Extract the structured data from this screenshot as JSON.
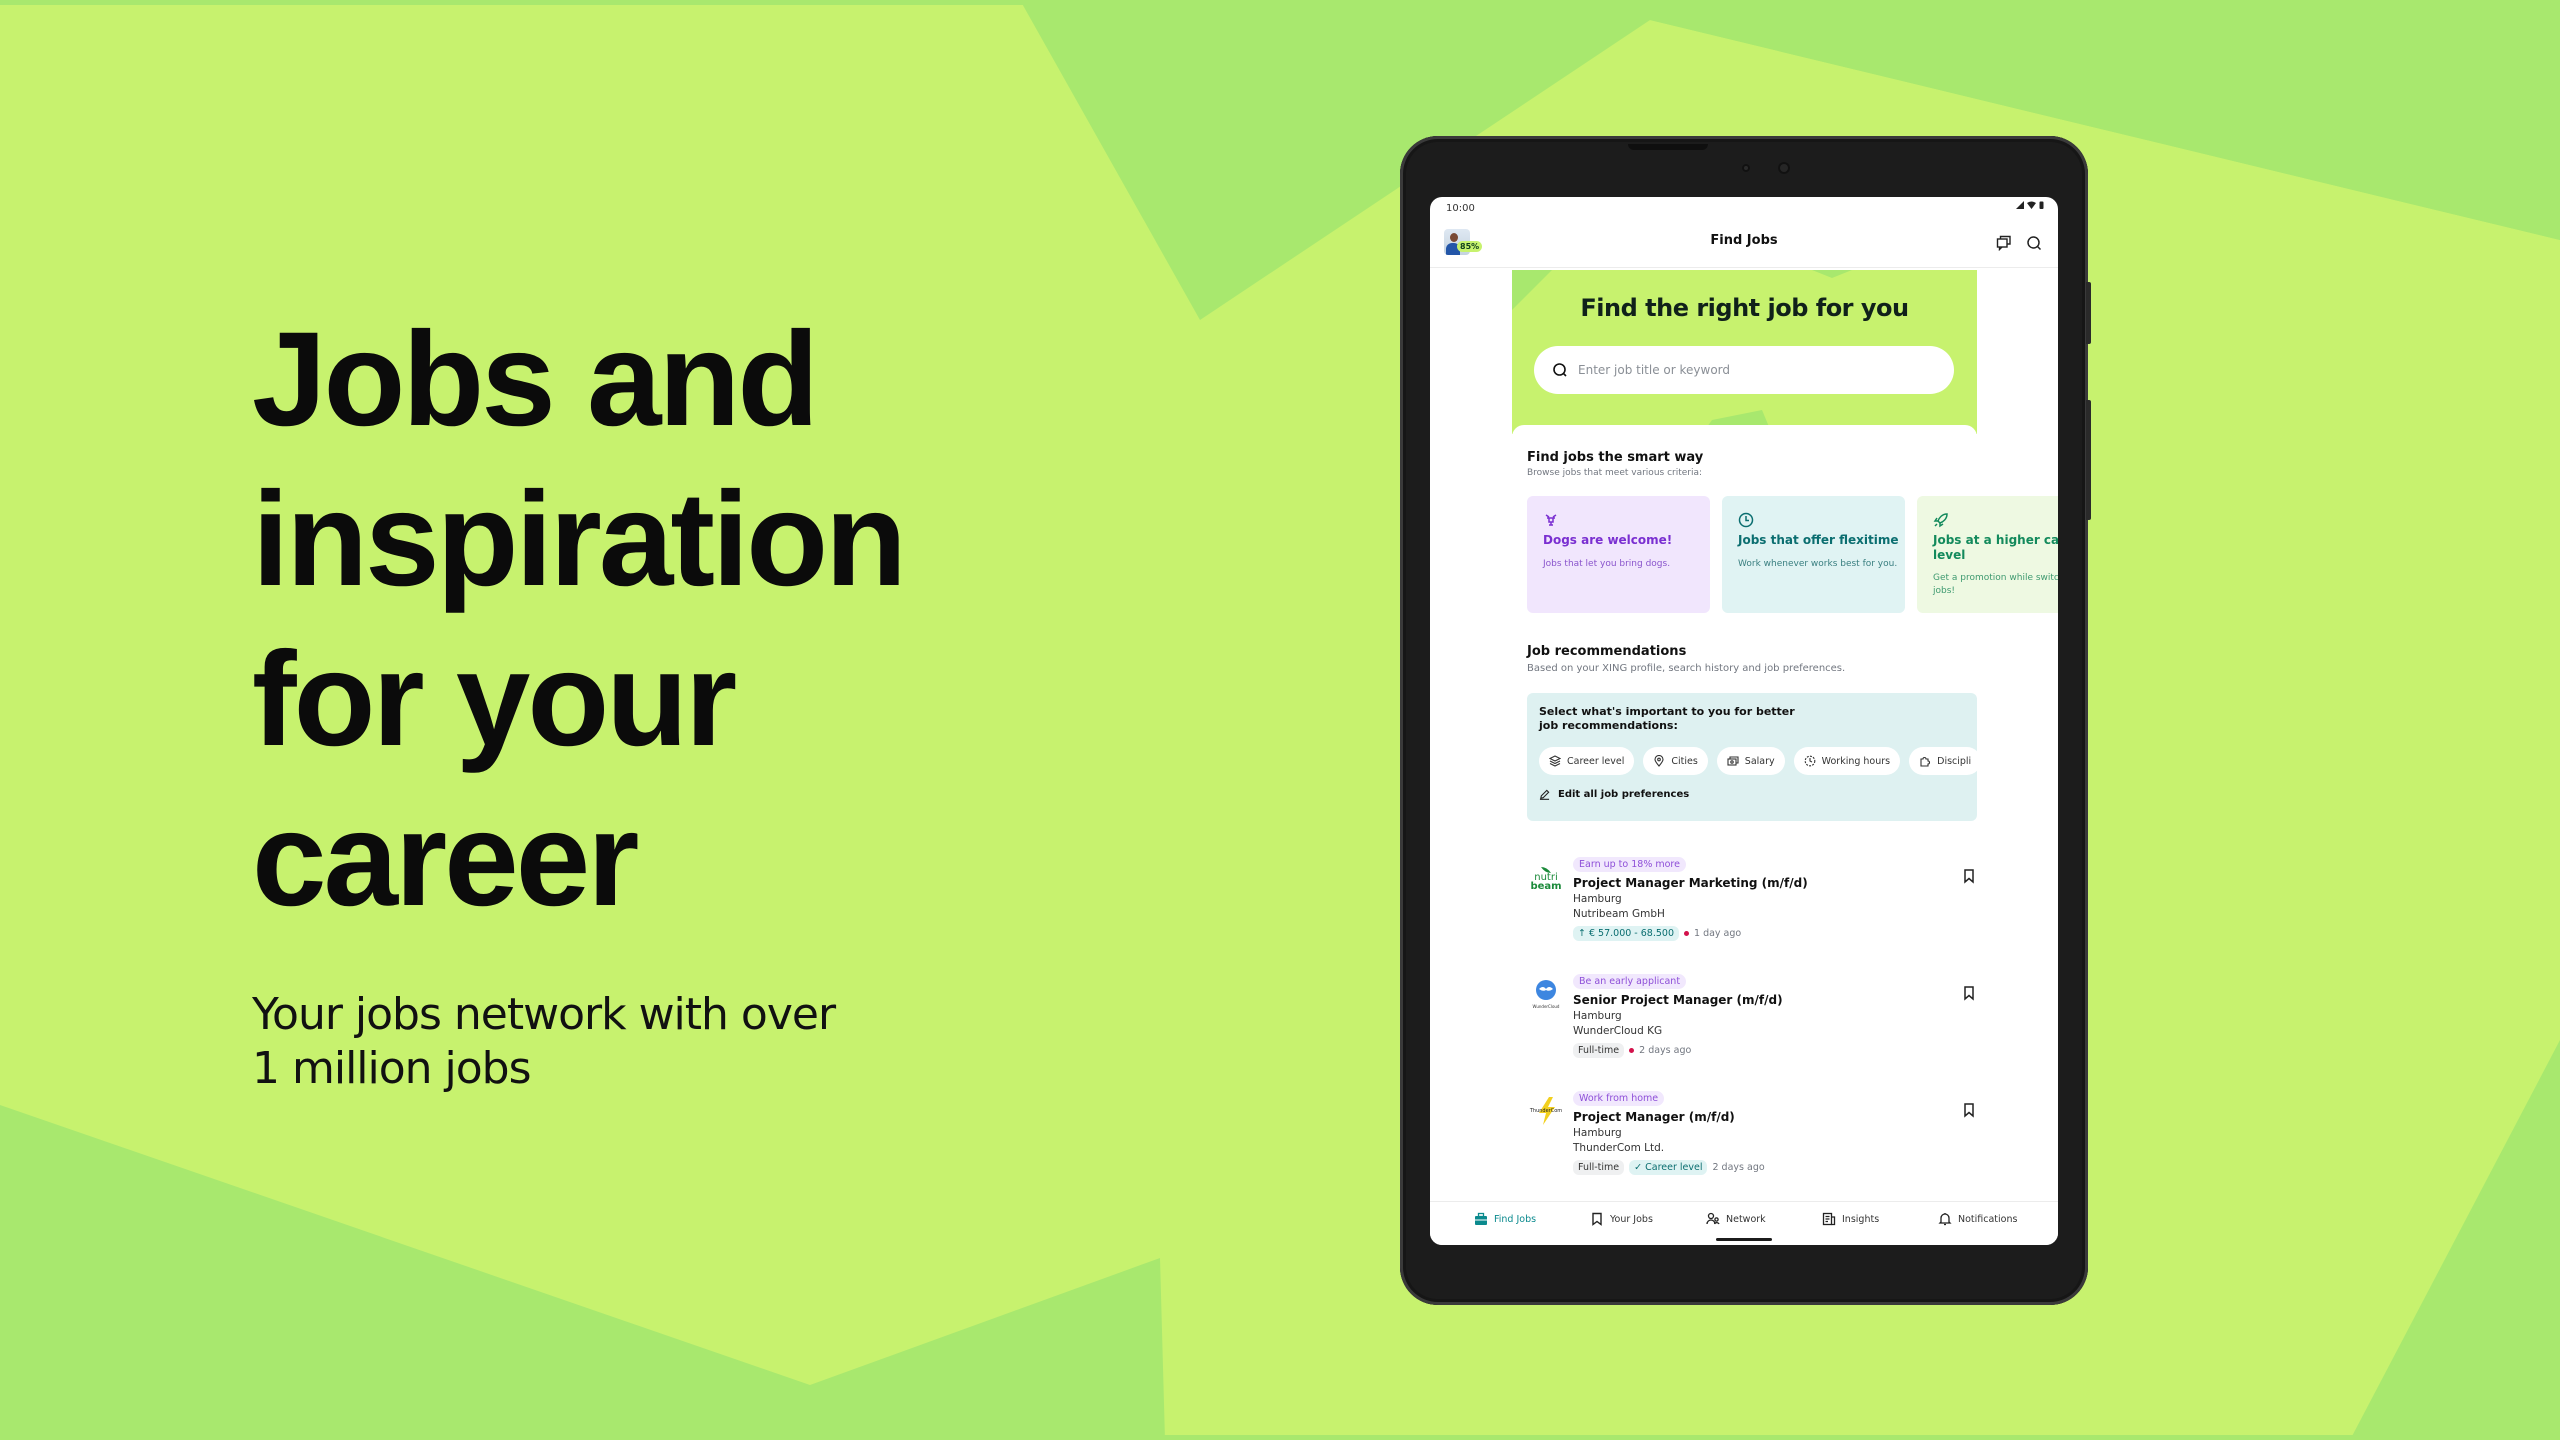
{
  "colors": {
    "background": "#c7f26e",
    "background_shapes": "#a8e86e",
    "accent_teal": "#0b8a8e",
    "accent_purple": "#8e4fd8",
    "status_dot": "#d3124b"
  },
  "promo": {
    "headline_lines": [
      "Jobs and",
      "inspiration",
      "for your",
      "career"
    ],
    "subline_lines": [
      "Your jobs network with over",
      "1 million jobs"
    ]
  },
  "device": {
    "status_bar": {
      "time": "10:00",
      "icons": [
        "signal-icon",
        "wifi-icon",
        "battery-icon"
      ]
    },
    "app_bar": {
      "title": "Find Jobs",
      "profile_completion": "85%",
      "actions": [
        "chat-icon",
        "search-icon"
      ]
    },
    "hero": {
      "title": "Find the right job for you",
      "search_placeholder": "Enter job title or keyword",
      "search_value": ""
    },
    "smart_way": {
      "title": "Find jobs the smart way",
      "subtitle": "Browse jobs that meet various criteria:",
      "cards": [
        {
          "icon": "dog-icon",
          "title": "Dogs are welcome!",
          "description": "Jobs that let you bring dogs."
        },
        {
          "icon": "clock-icon",
          "title": "Jobs that offer flexitime",
          "description": "Work whenever works best for you."
        },
        {
          "icon": "rocket-icon",
          "title": "Jobs at a higher career level",
          "description": "Get a promotion while switching jobs!"
        }
      ]
    },
    "recommendations": {
      "title": "Job recommendations",
      "subtitle": "Based on your XING profile, search history and job preferences.",
      "preferences_prompt": "Select what's important to you for better job recommendations:",
      "chips": [
        {
          "icon": "layers-icon",
          "label": "Career level"
        },
        {
          "icon": "location-pin-icon",
          "label": "Cities"
        },
        {
          "icon": "money-icon",
          "label": "Salary"
        },
        {
          "icon": "clock-dashed-icon",
          "label": "Working hours"
        },
        {
          "icon": "puzzle-icon",
          "label": "Discipli"
        }
      ],
      "edit_label": "Edit all job preferences"
    },
    "jobs": [
      {
        "tag": "Earn up to 18% more",
        "title": "Project Manager Marketing (m/f/d)",
        "location": "Hamburg",
        "company": "Nutribeam GmbH",
        "logo_text": [
          "nutri",
          "beam"
        ],
        "salary": "↑ € 57.000 - 68.500",
        "posted": "1 day ago",
        "new": true
      },
      {
        "tag": "Be an early applicant",
        "title": "Senior Project Manager (m/f/d)",
        "location": "Hamburg",
        "company": "WunderCloud KG",
        "logo_text": [
          "WunderCloud"
        ],
        "employment": "Full-time",
        "posted": "2 days ago",
        "new": true
      },
      {
        "tag": "Work from home",
        "title": "Project Manager (m/f/d)",
        "location": "Hamburg",
        "company": "ThunderCom Ltd.",
        "logo_text": [
          "ThunderCom"
        ],
        "employment": "Full-time",
        "match": "✓ Career level",
        "posted": "2 days ago",
        "new": false
      }
    ],
    "bottom_nav": [
      {
        "icon": "briefcase-icon",
        "label": "Find Jobs",
        "active": true
      },
      {
        "icon": "bookmark-icon",
        "label": "Your Jobs",
        "active": false
      },
      {
        "icon": "people-icon",
        "label": "Network",
        "active": false
      },
      {
        "icon": "article-icon",
        "label": "Insights",
        "active": false
      },
      {
        "icon": "bell-icon",
        "label": "Notifications",
        "active": false
      }
    ]
  }
}
